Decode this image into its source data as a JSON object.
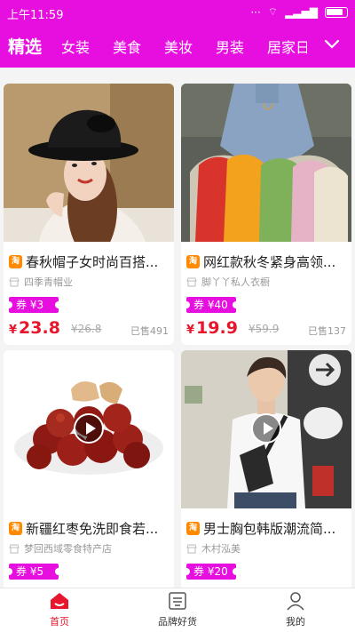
{
  "status_bar": {
    "time": "上午11:59",
    "dots": "···",
    "wifi": "⌔",
    "signal": "▂▃▅▇"
  },
  "tabs": [
    {
      "label": "精选",
      "active": true
    },
    {
      "label": "女装"
    },
    {
      "label": "美食"
    },
    {
      "label": "美妆"
    },
    {
      "label": "男装"
    },
    {
      "label": "居家日"
    }
  ],
  "more_icon": "chevron-down-icon",
  "products": [
    {
      "title": "春秋帽子女时尚百搭...",
      "shop": "四季青帽业",
      "coupon": "券 ¥3",
      "currency": "¥",
      "price": "23.8",
      "orig": "¥26.8",
      "sold": "已售491",
      "video": false
    },
    {
      "title": "网红款秋冬紧身高领...",
      "shop": "脚丫丫私人衣橱",
      "coupon": "券 ¥40",
      "currency": "¥",
      "price": "19.9",
      "orig": "¥59.9",
      "sold": "已售137",
      "video": false
    },
    {
      "title": "新疆红枣免洗即食若...",
      "shop": "梦回西域零食特产店",
      "coupon": "券 ¥5",
      "video": true
    },
    {
      "title": "男士胸包韩版潮流简...",
      "shop": "木村泓美",
      "coupon": "券 ¥20",
      "video": true
    }
  ],
  "badge_text": "淘",
  "bottom_nav": [
    {
      "label": "首页",
      "active": true
    },
    {
      "label": "品牌好货"
    },
    {
      "label": "我的"
    }
  ],
  "colors": {
    "brand": "#e70fe0",
    "price": "#e6162d"
  }
}
